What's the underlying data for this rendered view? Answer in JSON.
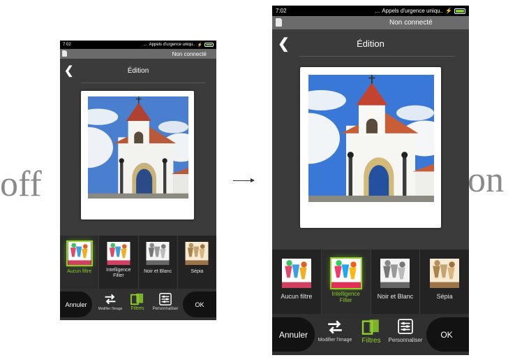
{
  "labels": {
    "before": "off",
    "after": "on"
  },
  "status_bar": {
    "time": "7:02",
    "dots": "...",
    "carrier": "Appels d'urgence uniqu..",
    "bolt": "⚡"
  },
  "connection": {
    "text": "Non connecté"
  },
  "header": {
    "title": "Édition",
    "back_icon": "chevron-left-icon"
  },
  "filters": [
    {
      "label": "Aucun filtre",
      "style": "color"
    },
    {
      "label": "Intelligence Filter",
      "style": "color"
    },
    {
      "label": "Noir et Blanc",
      "style": "bw"
    },
    {
      "label": "Sépia",
      "style": "sepia"
    }
  ],
  "toolbar": {
    "cancel": "Annuler",
    "ok": "OK",
    "tools": [
      {
        "label": "Modifier l'image",
        "icon": "swap-arrows-icon"
      },
      {
        "label": "Filtres",
        "icon": "filter-squares-icon"
      },
      {
        "label": "Personnaliser",
        "icon": "sliders-icon"
      }
    ]
  },
  "colors": {
    "accent": "#8fd12a",
    "battery": "#7fd321",
    "background": "#3b3b3b",
    "filter_strip": "#232323",
    "toolbar": "#303030"
  },
  "screens": [
    {
      "name": "before",
      "active_filter_index": 0,
      "active_tool_index": 1
    },
    {
      "name": "after",
      "active_filter_index": 1,
      "active_tool_index": 1
    }
  ]
}
